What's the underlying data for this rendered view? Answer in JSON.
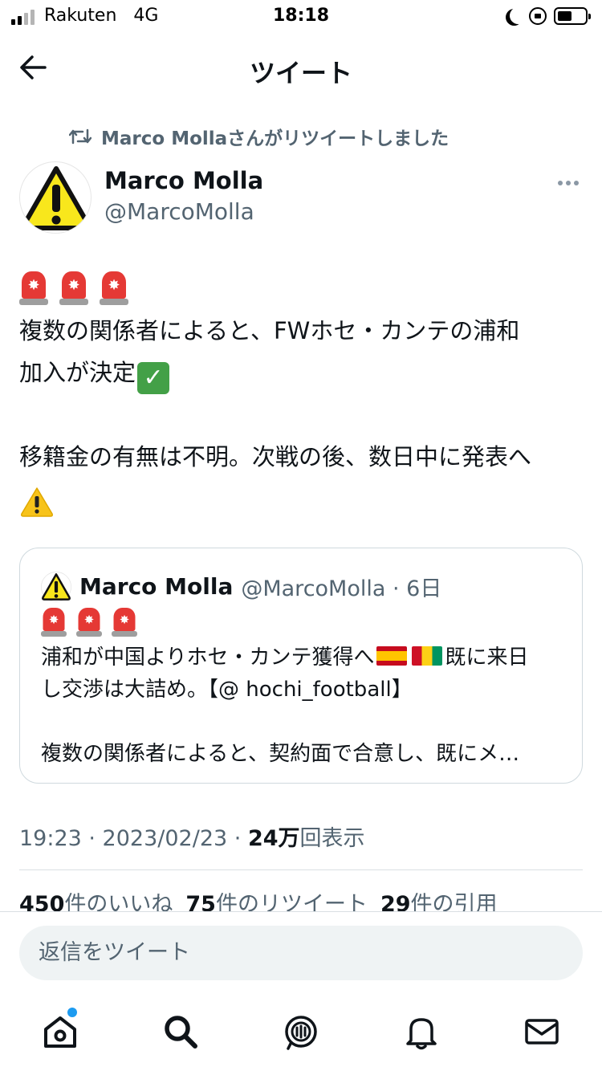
{
  "status_bar": {
    "carrier": "Rakuten",
    "network": "4G",
    "time": "18:18",
    "signal_bars_filled": 2,
    "signal_bars_total": 4,
    "battery_level": 0.4
  },
  "header": {
    "title": "ツイート",
    "back_icon": "arrow-left-icon"
  },
  "retweet_context": {
    "text": "Marco Mollaさんがリツイートしました",
    "icon": "retweet-icon"
  },
  "author": {
    "name": "Marco Molla",
    "handle": "@MarcoMolla",
    "avatar_icon": "warning-icon"
  },
  "tweet": {
    "line1": "複数の関係者によると、FWホセ・カンテの浦和",
    "line2": "加入が決定",
    "line3": "移籍金の有無は不明。次戦の後、数日中に発表へ"
  },
  "quote": {
    "name": "Marco Molla",
    "handle": "@MarcoMolla · 6日",
    "line1_a": "浦和が中国よりホセ・カンテ獲得へ",
    "line1_b": "既に来日",
    "line2": "し交渉は大詰め。【@ hochi_football】",
    "line3": "複数の関係者によると、契約面で合意し、既にメ…"
  },
  "meta": {
    "time": "19:23 · 2023/02/23 · ",
    "views_count": "24万",
    "views_label": "回表示"
  },
  "stats": {
    "likes_count": "450",
    "likes_label": "件のいいね",
    "retweets_count": "75",
    "retweets_label": "件のリツイート",
    "quotes_count": "29",
    "quotes_label": "件の引用"
  },
  "reply": {
    "placeholder": "返信をツイート"
  },
  "colors": {
    "text_primary": "#0f1419",
    "text_secondary": "#536471",
    "accent": "#1d9bf0",
    "border": "#cfd9de"
  },
  "tab_bar": {
    "tabs": [
      "home-icon",
      "search-icon",
      "spaces-icon",
      "notifications-icon",
      "messages-icon"
    ],
    "home_has_notification": true
  }
}
